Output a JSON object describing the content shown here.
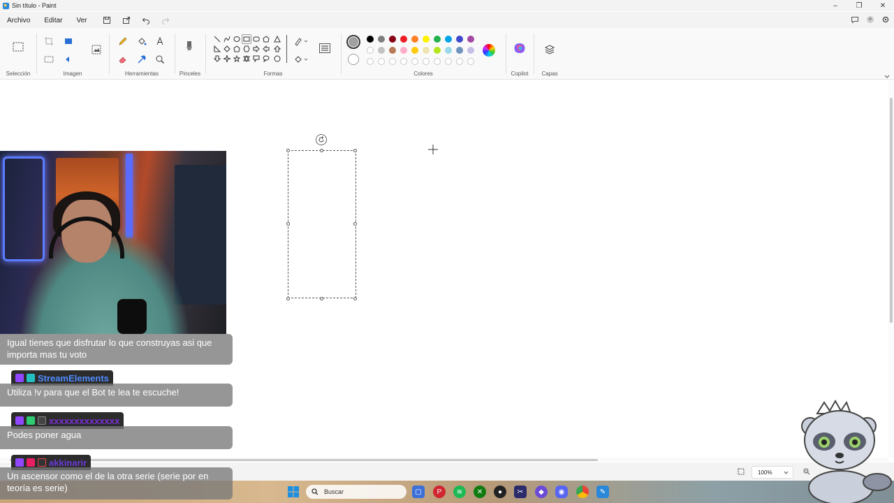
{
  "window": {
    "title": "Sin título - Paint",
    "controls": [
      "–",
      "❐",
      "✕"
    ]
  },
  "menu": {
    "items": [
      "Archivo",
      "Editar",
      "Ver"
    ]
  },
  "ribbon": {
    "groups": {
      "selection": "Selección",
      "image": "Imagen",
      "tools": "Herramientas",
      "brushes": "Pinceles",
      "shapes": "Formas",
      "colors": "Colores",
      "copilot": "Copilot",
      "layers": "Capas"
    },
    "palette_row1": [
      "#000000",
      "#7f7f7f",
      "#880015",
      "#ed1c24",
      "#ff7f27",
      "#fff200",
      "#22b14c",
      "#00a2e8",
      "#3f48cc",
      "#a349a4"
    ],
    "palette_row2": [
      "#ffffff",
      "#c3c3c3",
      "#b97a57",
      "#ffaec9",
      "#ffc90e",
      "#efe4b0",
      "#b5e61d",
      "#99d9ea",
      "#7092be",
      "#c8bfe7"
    ],
    "primary_color": "#a0a0a0",
    "secondary_color": "#ffffff"
  },
  "statusbar": {
    "zoom": "100%"
  },
  "taskbar": {
    "search_placeholder": "Buscar"
  },
  "chat": {
    "messages": [
      {
        "user": "",
        "text": "Igual tienes que disfrutar lo que construyas asi que importa mas tu voto"
      },
      {
        "user": "StreamElements",
        "user_color": "#4e8cff",
        "text": "Utiliza !v para que el Bot te lea te escuche!"
      },
      {
        "user": "xxxxxxxxxxxxxx",
        "user_color": "#7a2fd6",
        "text": "Podes poner agua"
      },
      {
        "user": "akkinarir",
        "user_color": "#6a3ad6",
        "text": "Un ascensor como el de la otra serie (serie por en teoría es serie)"
      }
    ]
  }
}
